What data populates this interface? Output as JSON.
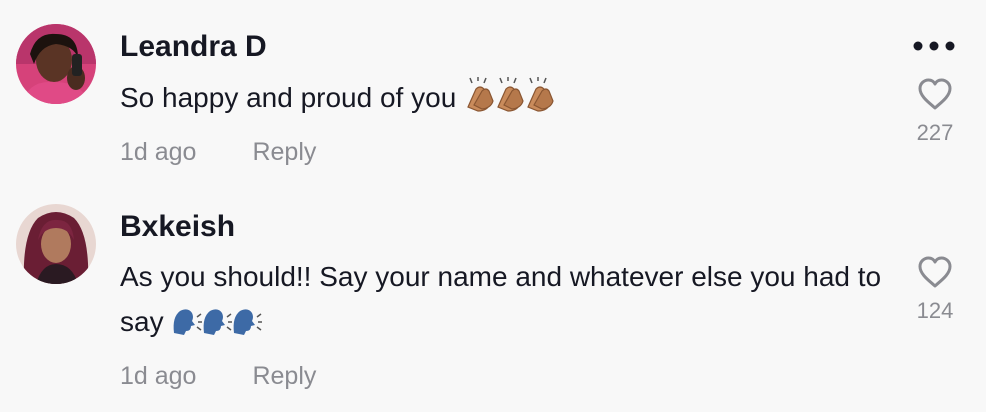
{
  "comments": [
    {
      "username": "Leandra D",
      "text": "So happy and proud of you",
      "emoji": "clapping-hands-medium-skin-tone x3",
      "time": "1d ago",
      "reply_label": "Reply",
      "likes": "227"
    },
    {
      "username": "Bxkeish",
      "text": "As you should!! Say your name and whatever else you had to say",
      "emoji": "speaking-head x3",
      "time": "1d ago",
      "reply_label": "Reply",
      "likes": "124"
    }
  ],
  "colors": {
    "background": "#f8f8f8",
    "text": "#161823",
    "secondary": "#8a8b91",
    "clap": "#c98b5b",
    "speaking_head": "#3d6aa6"
  }
}
